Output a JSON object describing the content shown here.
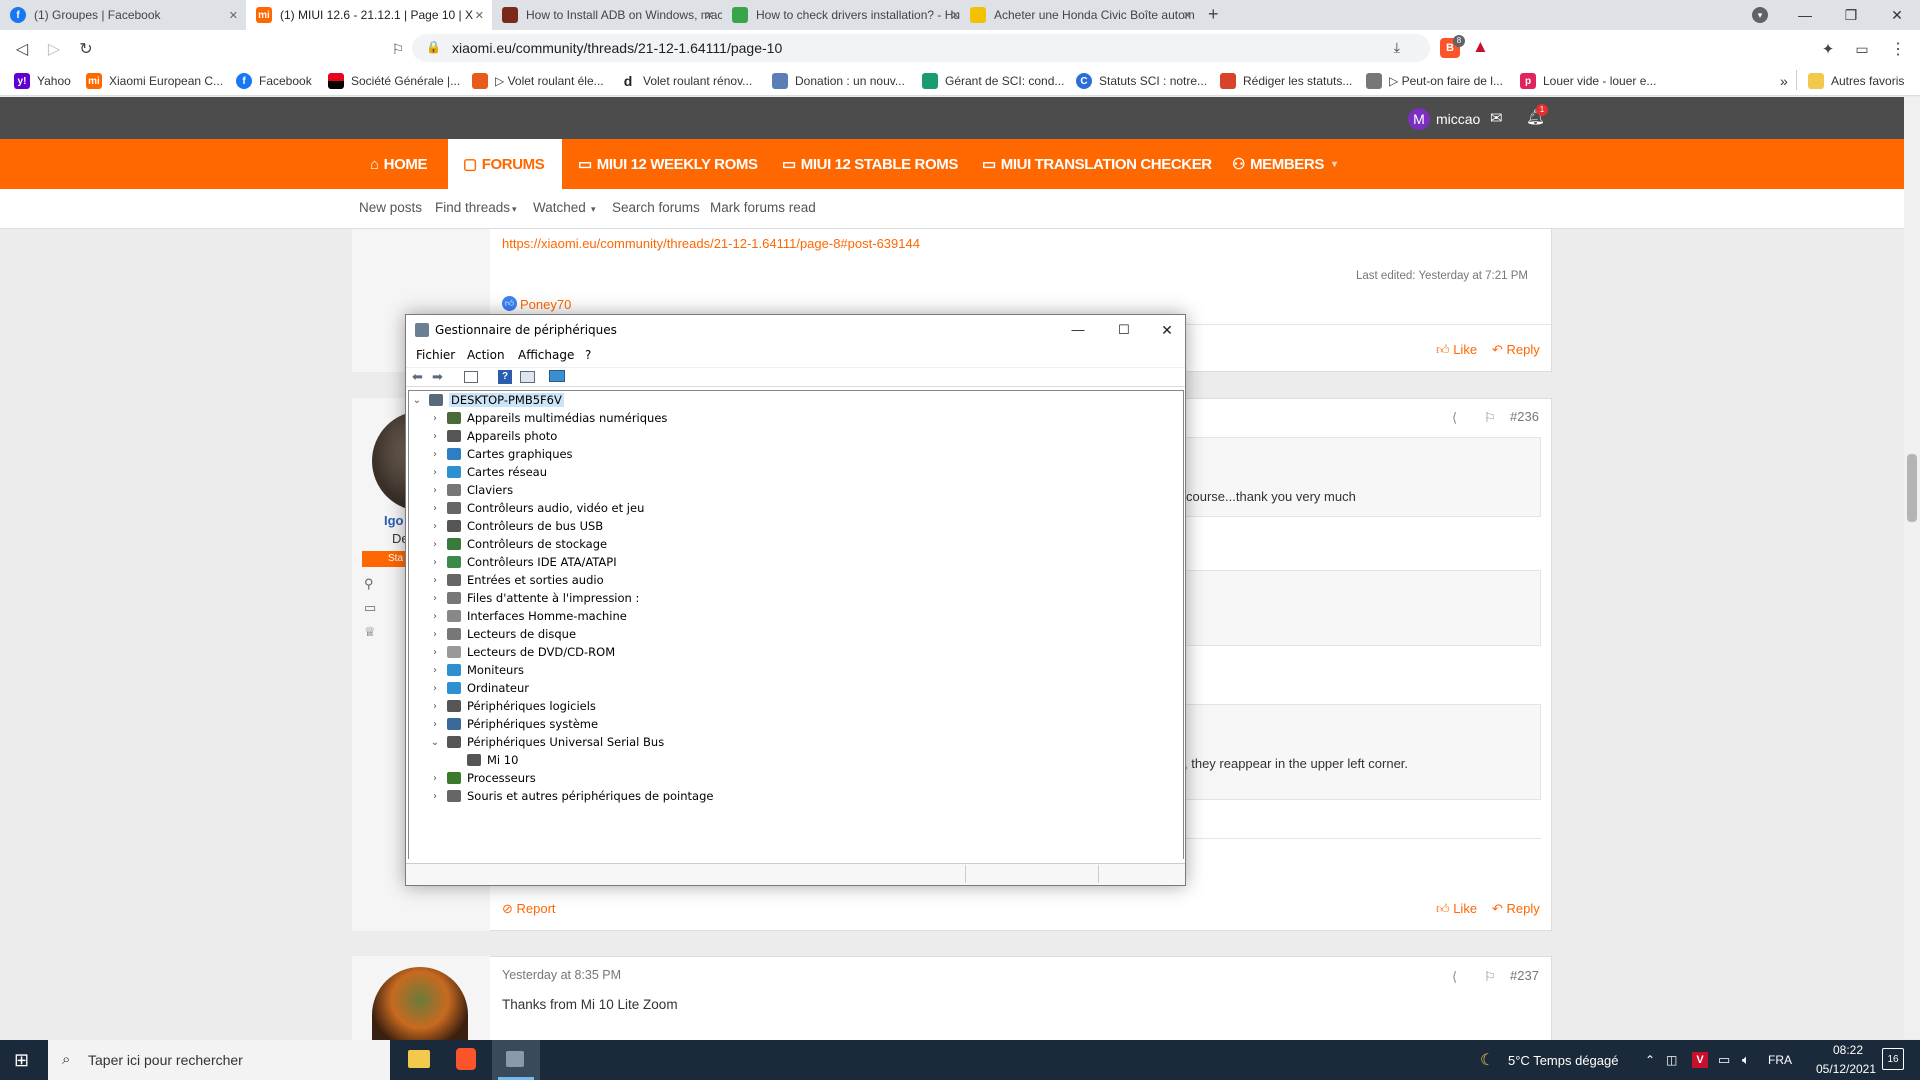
{
  "browser": {
    "tabs": [
      {
        "title": "(1) Groupes | Facebook",
        "icon": "facebook-icon",
        "color": "#1877f2"
      },
      {
        "title": "(1) MIUI 12.6 - 21.12.1 | Page 10 | X",
        "icon": "mi-icon",
        "color": "#ff6700"
      },
      {
        "title": "How to Install ADB on Windows, mac",
        "icon": "site-icon",
        "color": "#7a2a1a"
      },
      {
        "title": "How to check drivers installation? - Hu",
        "icon": "site-icon",
        "color": "#3aa44a"
      },
      {
        "title": "Acheter une Honda Civic Boîte autom",
        "icon": "site-icon",
        "color": "#f2c200"
      }
    ],
    "new_tab": "+",
    "url": "xiaomi.eu/community/threads/21-12-1.64111/page-10",
    "brave_badge": "8",
    "bookmarks": [
      {
        "label": "Yahoo",
        "color": "#6001d2"
      },
      {
        "label": "Xiaomi European C...",
        "color": "#ff6700"
      },
      {
        "label": "Facebook",
        "color": "#1877f2"
      },
      {
        "label": "Société Générale |...",
        "color": "#e9041e"
      },
      {
        "label": "▷ Volet roulant éle...",
        "color": "#e85a1b"
      },
      {
        "label": "Volet roulant rénov...",
        "color": "#222222"
      },
      {
        "label": "Donation : un nouv...",
        "color": "#5a7fb5"
      },
      {
        "label": "Gérant de SCI: cond...",
        "color": "#1a9c6e"
      },
      {
        "label": "Statuts SCI : notre...",
        "color": "#2a6fd6"
      },
      {
        "label": "Rédiger les statuts...",
        "color": "#d8432b"
      },
      {
        "label": "▷ Peut-on faire de l...",
        "color": "#777777"
      },
      {
        "label": "Louer vide - louer e...",
        "color": "#e0245e"
      }
    ],
    "bookmarks_overflow": "»",
    "other_bookmarks": "Autres favoris"
  },
  "site": {
    "user": {
      "initial": "M",
      "name": "miccao",
      "notif_count": "1",
      "avatar_color": "#7b2fbe"
    },
    "nav": [
      {
        "label": "HOME",
        "icon": "home-icon"
      },
      {
        "label": "FORUMS",
        "icon": "forums-icon",
        "active": true
      },
      {
        "label": "MIUI 12 WEEKLY ROMS",
        "icon": "folder-icon"
      },
      {
        "label": "MIUI 12 STABLE ROMS",
        "icon": "folder-icon"
      },
      {
        "label": "MIUI TRANSLATION CHECKER",
        "icon": "folder-icon"
      },
      {
        "label": "MEMBERS",
        "icon": "members-icon"
      }
    ],
    "subnav": [
      "New posts",
      "Find threads",
      "Watched",
      "Search forums",
      "Mark forums read"
    ],
    "post_prev": {
      "link": "https://xiaomi.eu/community/threads/21-12-1.64111/page-8#post-639144",
      "last_edited": "Last edited: Yesterday at 7:21 PM",
      "reaction_user": "Poney70",
      "like": "Like",
      "reply": "Reply"
    },
    "post_236": {
      "number": "#236",
      "author_fragment": "Igo",
      "title_fragment": "De",
      "badge_fragment": "Sta",
      "text_1": "course...thank you very much",
      "text_2": ", they reappear in the upper left corner.",
      "report": "Report",
      "like": "Like",
      "reply": "Reply"
    },
    "post_237": {
      "number": "#237",
      "date": "Yesterday at 8:35 PM",
      "text": "Thanks from Mi 10 Lite Zoom"
    }
  },
  "device_manager": {
    "title": "Gestionnaire de périphériques",
    "menu": [
      "Fichier",
      "Action",
      "Affichage",
      "?"
    ],
    "root": "DESKTOP-PMB5F6V",
    "items": [
      {
        "label": "Appareils multimédias numériques",
        "color": "#4a6a3a"
      },
      {
        "label": "Appareils photo",
        "color": "#555555"
      },
      {
        "label": "Cartes graphiques",
        "color": "#2e7fc1"
      },
      {
        "label": "Cartes réseau",
        "color": "#2e8fd1"
      },
      {
        "label": "Claviers",
        "color": "#777777"
      },
      {
        "label": "Contrôleurs audio, vidéo et jeu",
        "color": "#666666"
      },
      {
        "label": "Contrôleurs de bus USB",
        "color": "#555555"
      },
      {
        "label": "Contrôleurs de stockage",
        "color": "#3a7a3a"
      },
      {
        "label": "Contrôleurs IDE ATA/ATAPI",
        "color": "#3a8a4a"
      },
      {
        "label": "Entrées et sorties audio",
        "color": "#666666"
      },
      {
        "label": "Files d'attente à l'impression :",
        "color": "#777777"
      },
      {
        "label": "Interfaces Homme-machine",
        "color": "#888888"
      },
      {
        "label": "Lecteurs de disque",
        "color": "#777777"
      },
      {
        "label": "Lecteurs de DVD/CD-ROM",
        "color": "#999999"
      },
      {
        "label": "Moniteurs",
        "color": "#2e8fd1"
      },
      {
        "label": "Ordinateur",
        "color": "#2e8fd1"
      },
      {
        "label": "Périphériques logiciels",
        "color": "#555555"
      },
      {
        "label": "Périphériques système",
        "color": "#3a6a9a"
      },
      {
        "label": "Périphériques Universal Serial Bus",
        "color": "#555555",
        "expanded": true
      },
      {
        "label": "Mi 10",
        "color": "#555555",
        "child": true
      },
      {
        "label": "Processeurs",
        "color": "#3a7a2a"
      },
      {
        "label": "Souris et autres périphériques de pointage",
        "color": "#666666"
      }
    ]
  },
  "taskbar": {
    "search_placeholder": "Taper ici pour rechercher",
    "weather": "5°C  Temps dégagé",
    "language": "FRA",
    "time": "08:22",
    "date": "05/12/2021",
    "notifications": "16"
  }
}
